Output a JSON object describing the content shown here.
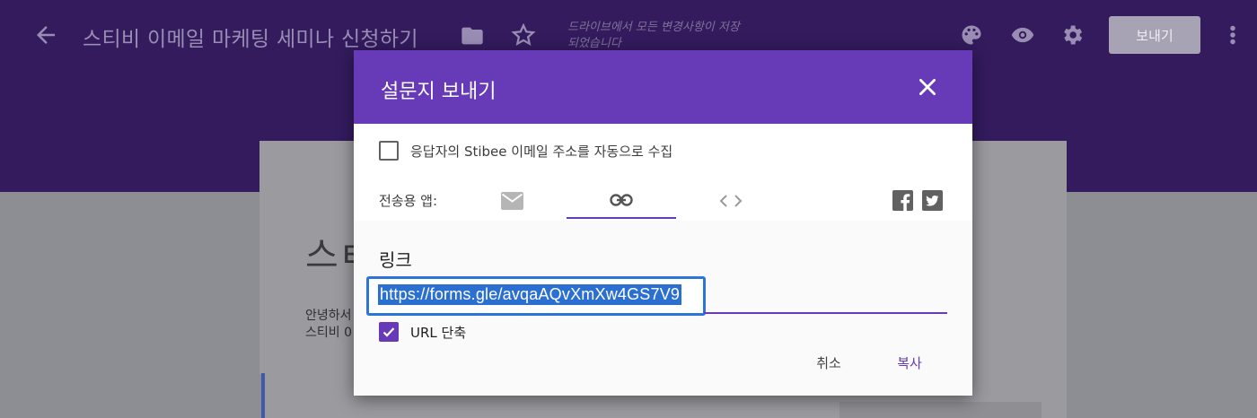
{
  "header": {
    "title": "스티비 이메일 마케팅 세미나 신청하기",
    "save_status": "드라이브에서 모든 변경사항이 저장되었습니다",
    "send_label": "보내기",
    "icons": [
      "back-arrow-icon",
      "folder-icon",
      "star-icon",
      "palette-icon",
      "eye-icon",
      "gear-icon",
      "more-vert-icon"
    ]
  },
  "form": {
    "title_fragment": "스ㅌ",
    "desc_line1": "안녕하서",
    "desc_line2": "스티비 0"
  },
  "dialog": {
    "title": "설문지 보내기",
    "collect_label": "응답자의 Stibee 이메일 주소를 자동으로 수집",
    "collect_checked": false,
    "send_via_label": "전송용 앱:",
    "tabs": [
      {
        "name": "email",
        "icon": "mail-icon",
        "active": false
      },
      {
        "name": "link",
        "icon": "link-icon",
        "active": true
      },
      {
        "name": "embed",
        "icon": "code-icon",
        "active": false
      }
    ],
    "social": [
      "facebook-icon",
      "twitter-icon"
    ],
    "section_title": "링크",
    "link_url": "https://forms.gle/avqaAQvXmXw4GS7V9",
    "shorten_label": "URL 단축",
    "shorten_checked": true,
    "cancel_label": "취소",
    "copy_label": "복사"
  },
  "colors": {
    "accent": "#673ab7",
    "selection": "#2b6fd0",
    "header_dimmed": "#331b5e"
  }
}
